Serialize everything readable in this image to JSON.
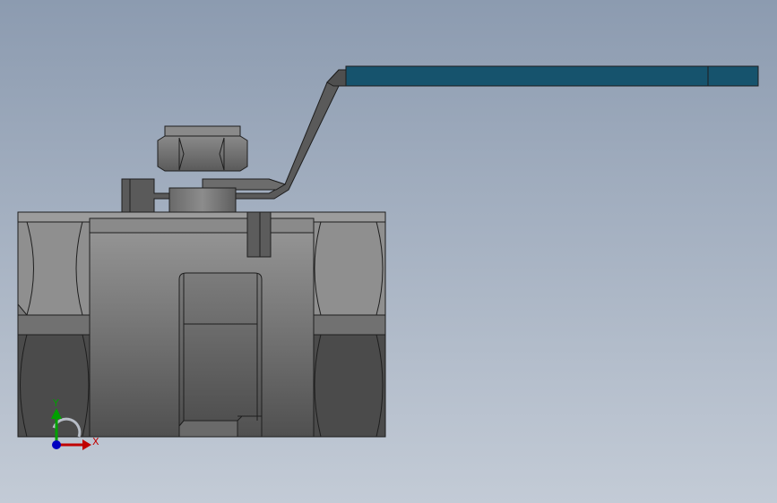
{
  "viewport": {
    "background_top": "#8c9bb0",
    "background_bottom": "#c3cbd6",
    "model": "ball-valve"
  },
  "colors": {
    "handle": "#16536d",
    "body_light": "#8f8f8f",
    "body_mid": "#6f6f6f",
    "body_dark": "#4a4a4a",
    "outline": "#1e1e1e",
    "axis_x": "#c00000",
    "axis_y": "#00a000",
    "axis_z": "#0000c0"
  },
  "triad": {
    "x_label": "X",
    "y_label": "Y"
  }
}
